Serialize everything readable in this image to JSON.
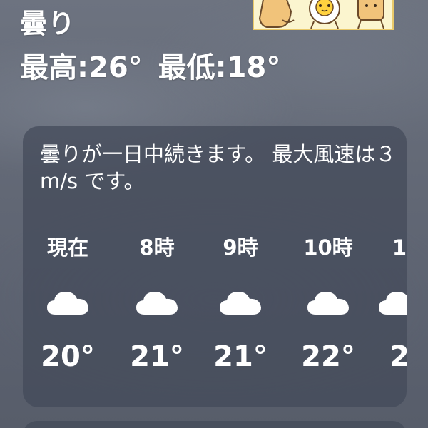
{
  "current": {
    "condition": "曇り",
    "high": "最高:26°",
    "low": "最低:18°"
  },
  "forecast": {
    "summary": "曇りが一日中続きます。 最大風速は３ m/s です。",
    "hours": [
      {
        "label": "現在",
        "icon": "cloud-icon",
        "temp": "20°"
      },
      {
        "label": "8時",
        "icon": "cloud-icon",
        "temp": "21°"
      },
      {
        "label": "9時",
        "icon": "cloud-icon",
        "temp": "21°"
      },
      {
        "label": "10時",
        "icon": "cloud-icon",
        "temp": "22°"
      },
      {
        "label": "1",
        "icon": "cloud-icon",
        "temp": "2"
      }
    ]
  },
  "colors": {
    "background": "#646a77",
    "card": "#434a59",
    "text": "#ffffff",
    "sticker_bg": "#fbf5cf",
    "sticker_border": "#e9c96a"
  }
}
